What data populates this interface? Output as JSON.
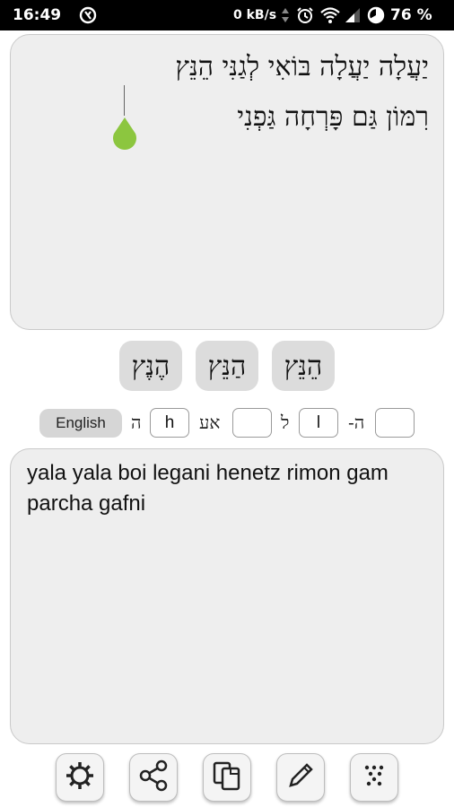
{
  "status_bar": {
    "time": "16:49",
    "net_speed": "0 kB/s",
    "battery_percent": "76 %",
    "icons": [
      "app-icon",
      "data-arrows-icon",
      "alarm-icon",
      "wifi-icon",
      "signal-icon",
      "battery-icon"
    ]
  },
  "hebrew_panel": {
    "line1": "יַעֲלָה יַעֲלָה בּוֹאִי לְגַנִּי הֵנֵּץ",
    "line2": "רִמּוֹן גַּם פָּרְחָה גַּפְנִי"
  },
  "suggestions": [
    "הֶנֶּץ",
    "הַנֵּץ",
    "הֵנֵּץ"
  ],
  "mapping": {
    "english_button": "English",
    "pairs": [
      {
        "hebrew": "ה",
        "latin": "h"
      },
      {
        "hebrew": "אע",
        "latin": ""
      },
      {
        "hebrew": "ל",
        "latin": "l"
      },
      {
        "hebrew": "ה-",
        "latin": ""
      }
    ]
  },
  "english_panel": {
    "text": "yala yala boi legani henetz rimon gam parcha gafni"
  },
  "toolbar": {
    "buttons": [
      "settings-icon",
      "share-icon",
      "copy-icon",
      "edit-icon",
      "dots-icon"
    ]
  },
  "colors": {
    "accent_green": "#8cc63f",
    "panel_bg": "#eeeeee",
    "button_bg": "#dcdcdc"
  }
}
